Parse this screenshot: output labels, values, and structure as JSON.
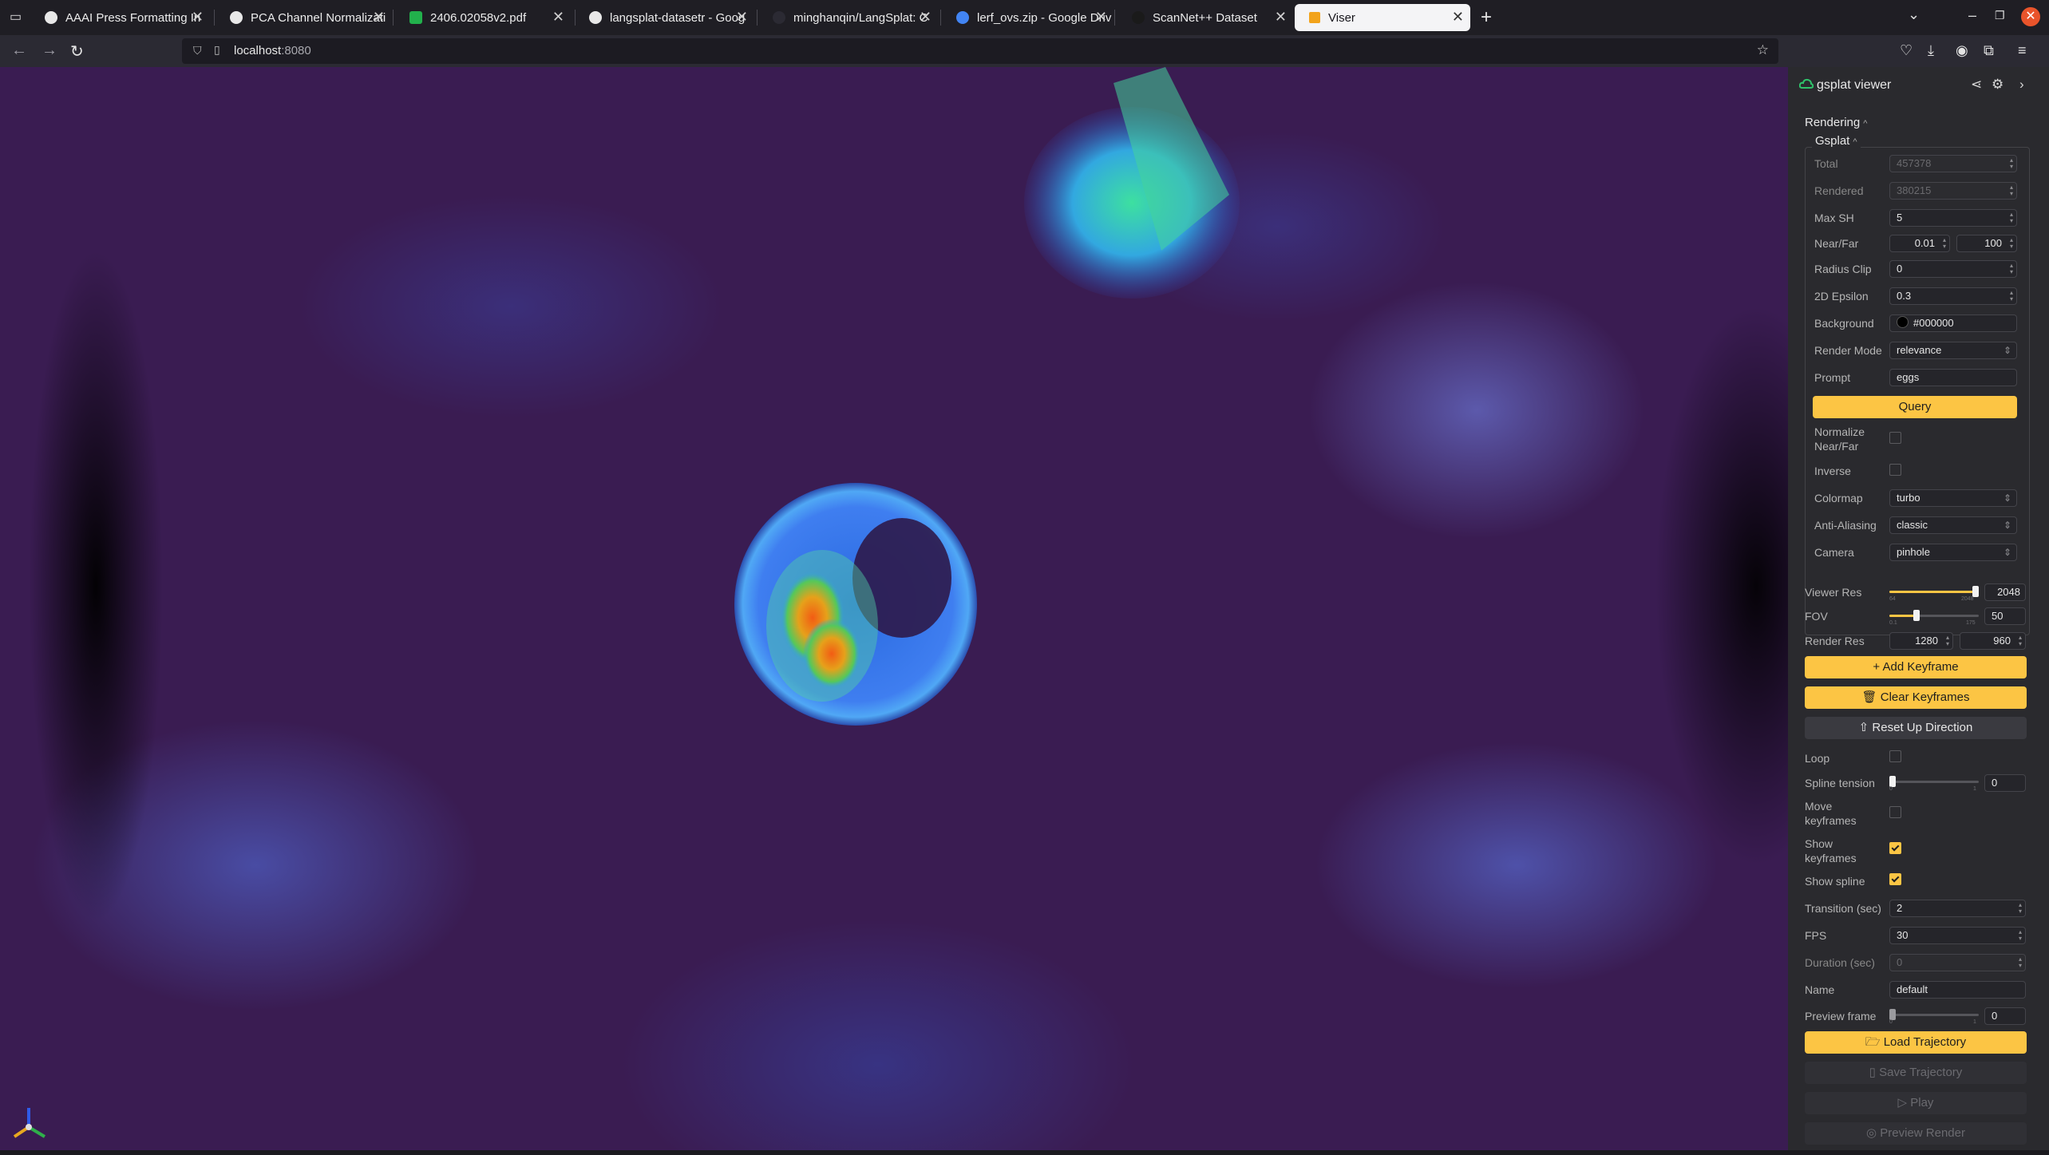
{
  "browser": {
    "tabs": [
      {
        "title": "AAAI Press Formatting In",
        "icon_color": "#e8e8e8",
        "active": false
      },
      {
        "title": "PCA Channel Normalizati",
        "icon_color": "#e8e8e8",
        "active": false
      },
      {
        "title": "2406.02058v2.pdf",
        "icon_color": "#22b14c",
        "active": false
      },
      {
        "title": "langsplat-datasetr - Goog",
        "icon_color": "#e8e8e8",
        "active": false
      },
      {
        "title": "minghanqin/LangSplat: C",
        "icon_color": "#2b2a33",
        "active": false
      },
      {
        "title": "lerf_ovs.zip - Google Driv",
        "icon_color": "#4285f4",
        "active": false
      },
      {
        "title": "ScanNet++ Dataset",
        "icon_color": "#1a1a1a",
        "active": false
      },
      {
        "title": "Viser",
        "icon_color": "#f2a31b",
        "active": true
      }
    ],
    "new_tab_glyph": "+",
    "url_host": "localhost",
    "url_port": ":8080"
  },
  "panel": {
    "title": "gsplat viewer",
    "sections": {
      "rendering": "Rendering",
      "gsplat": "Gsplat"
    },
    "fields": {
      "total": {
        "label": "Total",
        "value": "457378"
      },
      "rendered": {
        "label": "Rendered",
        "value": "380215"
      },
      "max_sh": {
        "label": "Max SH",
        "value": "5"
      },
      "near_far": {
        "label": "Near/Far",
        "near": "0.01",
        "far": "100"
      },
      "radius_clip": {
        "label": "Radius Clip",
        "value": "0"
      },
      "epsilon_2d": {
        "label": "2D Epsilon",
        "value": "0.3"
      },
      "background": {
        "label": "Background",
        "value": "#000000"
      },
      "render_mode": {
        "label": "Render Mode",
        "value": "relevance"
      },
      "prompt": {
        "label": "Prompt",
        "value": "eggs"
      },
      "query_button": "Query",
      "normalize": {
        "label_1": "Normalize",
        "label_2": "Near/Far",
        "checked": false
      },
      "inverse": {
        "label": "Inverse",
        "checked": false
      },
      "colormap": {
        "label": "Colormap",
        "value": "turbo"
      },
      "anti_aliasing": {
        "label": "Anti-Aliasing",
        "value": "classic"
      },
      "camera": {
        "label": "Camera",
        "value": "pinhole"
      }
    },
    "viewer": {
      "viewer_res": {
        "label": "Viewer Res",
        "value": "2048",
        "min_tick": "64",
        "max_tick": "2048",
        "fraction": 1.0
      },
      "fov": {
        "label": "FOV",
        "value": "50",
        "min_tick": "0.1",
        "max_tick": "175",
        "fraction": 0.286
      },
      "render_res": {
        "label": "Render Res",
        "width": "1280",
        "height": "960"
      },
      "add_keyframe": "+ Add Keyframe",
      "clear_keyframes": "Clear Keyframes",
      "reset_up": "Reset Up Direction",
      "loop": {
        "label": "Loop",
        "checked": false
      },
      "spline_tension": {
        "label": "Spline tension",
        "value": "0",
        "min_tick": "0",
        "max_tick": "1",
        "fraction": 0.0
      },
      "move_keyframes": {
        "label_1": "Move",
        "label_2": "keyframes",
        "checked": false
      },
      "show_keyframes": {
        "label_1": "Show",
        "label_2": "keyframes",
        "checked": true
      },
      "show_spline": {
        "label": "Show spline",
        "checked": true
      },
      "transition": {
        "label": "Transition (sec)",
        "value": "2"
      },
      "fps": {
        "label": "FPS",
        "value": "30"
      },
      "duration": {
        "label": "Duration (sec)",
        "value": "0"
      },
      "name": {
        "label": "Name",
        "value": "default"
      },
      "preview_frame": {
        "label": "Preview frame",
        "value": "0",
        "min_tick": "0",
        "max_tick": "1",
        "fraction": 0.0
      },
      "load_trajectory": "Load Trajectory",
      "save_trajectory": "Save Trajectory",
      "play": "Play",
      "preview_render": "Preview Render"
    }
  },
  "colors": {
    "accent": "#fcc544",
    "panel_bg": "#2a2a2e",
    "scene_bg": "#3a1c52"
  }
}
